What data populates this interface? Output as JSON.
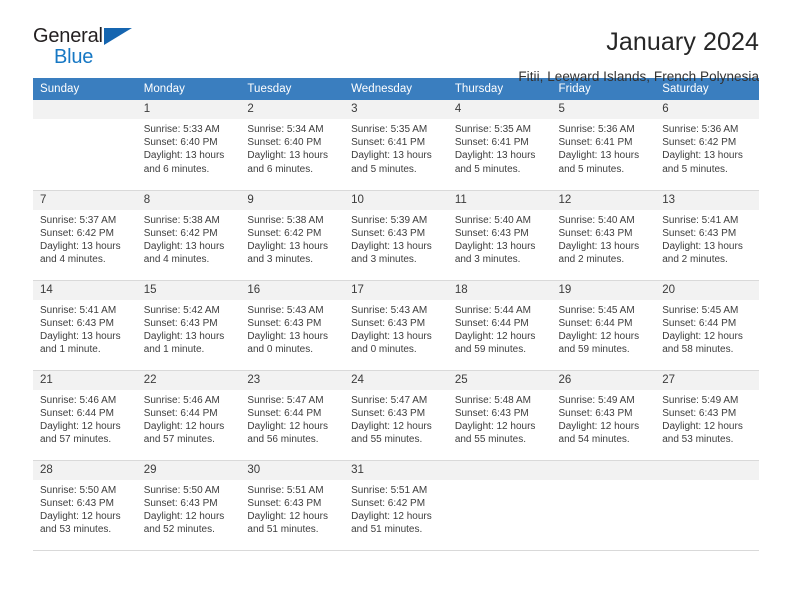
{
  "brand": {
    "name_top": "General",
    "name_bottom": "Blue",
    "triangle_color": "#1565b0",
    "blue_color": "#1778c4"
  },
  "header": {
    "title": "January 2024",
    "subtitle": "Fitii, Leeward Islands, French Polynesia",
    "accent_color": "#3a7ebf"
  },
  "calendar": {
    "weekday_headers": [
      "Sunday",
      "Monday",
      "Tuesday",
      "Wednesday",
      "Thursday",
      "Friday",
      "Saturday"
    ],
    "weeks": [
      [
        {
          "day": "",
          "sunrise": "",
          "sunset": "",
          "daylight_a": "",
          "daylight_b": ""
        },
        {
          "day": "1",
          "sunrise": "Sunrise: 5:33 AM",
          "sunset": "Sunset: 6:40 PM",
          "daylight_a": "Daylight: 13 hours",
          "daylight_b": "and 6 minutes."
        },
        {
          "day": "2",
          "sunrise": "Sunrise: 5:34 AM",
          "sunset": "Sunset: 6:40 PM",
          "daylight_a": "Daylight: 13 hours",
          "daylight_b": "and 6 minutes."
        },
        {
          "day": "3",
          "sunrise": "Sunrise: 5:35 AM",
          "sunset": "Sunset: 6:41 PM",
          "daylight_a": "Daylight: 13 hours",
          "daylight_b": "and 5 minutes."
        },
        {
          "day": "4",
          "sunrise": "Sunrise: 5:35 AM",
          "sunset": "Sunset: 6:41 PM",
          "daylight_a": "Daylight: 13 hours",
          "daylight_b": "and 5 minutes."
        },
        {
          "day": "5",
          "sunrise": "Sunrise: 5:36 AM",
          "sunset": "Sunset: 6:41 PM",
          "daylight_a": "Daylight: 13 hours",
          "daylight_b": "and 5 minutes."
        },
        {
          "day": "6",
          "sunrise": "Sunrise: 5:36 AM",
          "sunset": "Sunset: 6:42 PM",
          "daylight_a": "Daylight: 13 hours",
          "daylight_b": "and 5 minutes."
        }
      ],
      [
        {
          "day": "7",
          "sunrise": "Sunrise: 5:37 AM",
          "sunset": "Sunset: 6:42 PM",
          "daylight_a": "Daylight: 13 hours",
          "daylight_b": "and 4 minutes."
        },
        {
          "day": "8",
          "sunrise": "Sunrise: 5:38 AM",
          "sunset": "Sunset: 6:42 PM",
          "daylight_a": "Daylight: 13 hours",
          "daylight_b": "and 4 minutes."
        },
        {
          "day": "9",
          "sunrise": "Sunrise: 5:38 AM",
          "sunset": "Sunset: 6:42 PM",
          "daylight_a": "Daylight: 13 hours",
          "daylight_b": "and 3 minutes."
        },
        {
          "day": "10",
          "sunrise": "Sunrise: 5:39 AM",
          "sunset": "Sunset: 6:43 PM",
          "daylight_a": "Daylight: 13 hours",
          "daylight_b": "and 3 minutes."
        },
        {
          "day": "11",
          "sunrise": "Sunrise: 5:40 AM",
          "sunset": "Sunset: 6:43 PM",
          "daylight_a": "Daylight: 13 hours",
          "daylight_b": "and 3 minutes."
        },
        {
          "day": "12",
          "sunrise": "Sunrise: 5:40 AM",
          "sunset": "Sunset: 6:43 PM",
          "daylight_a": "Daylight: 13 hours",
          "daylight_b": "and 2 minutes."
        },
        {
          "day": "13",
          "sunrise": "Sunrise: 5:41 AM",
          "sunset": "Sunset: 6:43 PM",
          "daylight_a": "Daylight: 13 hours",
          "daylight_b": "and 2 minutes."
        }
      ],
      [
        {
          "day": "14",
          "sunrise": "Sunrise: 5:41 AM",
          "sunset": "Sunset: 6:43 PM",
          "daylight_a": "Daylight: 13 hours",
          "daylight_b": "and 1 minute."
        },
        {
          "day": "15",
          "sunrise": "Sunrise: 5:42 AM",
          "sunset": "Sunset: 6:43 PM",
          "daylight_a": "Daylight: 13 hours",
          "daylight_b": "and 1 minute."
        },
        {
          "day": "16",
          "sunrise": "Sunrise: 5:43 AM",
          "sunset": "Sunset: 6:43 PM",
          "daylight_a": "Daylight: 13 hours",
          "daylight_b": "and 0 minutes."
        },
        {
          "day": "17",
          "sunrise": "Sunrise: 5:43 AM",
          "sunset": "Sunset: 6:43 PM",
          "daylight_a": "Daylight: 13 hours",
          "daylight_b": "and 0 minutes."
        },
        {
          "day": "18",
          "sunrise": "Sunrise: 5:44 AM",
          "sunset": "Sunset: 6:44 PM",
          "daylight_a": "Daylight: 12 hours",
          "daylight_b": "and 59 minutes."
        },
        {
          "day": "19",
          "sunrise": "Sunrise: 5:45 AM",
          "sunset": "Sunset: 6:44 PM",
          "daylight_a": "Daylight: 12 hours",
          "daylight_b": "and 59 minutes."
        },
        {
          "day": "20",
          "sunrise": "Sunrise: 5:45 AM",
          "sunset": "Sunset: 6:44 PM",
          "daylight_a": "Daylight: 12 hours",
          "daylight_b": "and 58 minutes."
        }
      ],
      [
        {
          "day": "21",
          "sunrise": "Sunrise: 5:46 AM",
          "sunset": "Sunset: 6:44 PM",
          "daylight_a": "Daylight: 12 hours",
          "daylight_b": "and 57 minutes."
        },
        {
          "day": "22",
          "sunrise": "Sunrise: 5:46 AM",
          "sunset": "Sunset: 6:44 PM",
          "daylight_a": "Daylight: 12 hours",
          "daylight_b": "and 57 minutes."
        },
        {
          "day": "23",
          "sunrise": "Sunrise: 5:47 AM",
          "sunset": "Sunset: 6:44 PM",
          "daylight_a": "Daylight: 12 hours",
          "daylight_b": "and 56 minutes."
        },
        {
          "day": "24",
          "sunrise": "Sunrise: 5:47 AM",
          "sunset": "Sunset: 6:43 PM",
          "daylight_a": "Daylight: 12 hours",
          "daylight_b": "and 55 minutes."
        },
        {
          "day": "25",
          "sunrise": "Sunrise: 5:48 AM",
          "sunset": "Sunset: 6:43 PM",
          "daylight_a": "Daylight: 12 hours",
          "daylight_b": "and 55 minutes."
        },
        {
          "day": "26",
          "sunrise": "Sunrise: 5:49 AM",
          "sunset": "Sunset: 6:43 PM",
          "daylight_a": "Daylight: 12 hours",
          "daylight_b": "and 54 minutes."
        },
        {
          "day": "27",
          "sunrise": "Sunrise: 5:49 AM",
          "sunset": "Sunset: 6:43 PM",
          "daylight_a": "Daylight: 12 hours",
          "daylight_b": "and 53 minutes."
        }
      ],
      [
        {
          "day": "28",
          "sunrise": "Sunrise: 5:50 AM",
          "sunset": "Sunset: 6:43 PM",
          "daylight_a": "Daylight: 12 hours",
          "daylight_b": "and 53 minutes."
        },
        {
          "day": "29",
          "sunrise": "Sunrise: 5:50 AM",
          "sunset": "Sunset: 6:43 PM",
          "daylight_a": "Daylight: 12 hours",
          "daylight_b": "and 52 minutes."
        },
        {
          "day": "30",
          "sunrise": "Sunrise: 5:51 AM",
          "sunset": "Sunset: 6:43 PM",
          "daylight_a": "Daylight: 12 hours",
          "daylight_b": "and 51 minutes."
        },
        {
          "day": "31",
          "sunrise": "Sunrise: 5:51 AM",
          "sunset": "Sunset: 6:42 PM",
          "daylight_a": "Daylight: 12 hours",
          "daylight_b": "and 51 minutes."
        },
        {
          "day": "",
          "sunrise": "",
          "sunset": "",
          "daylight_a": "",
          "daylight_b": ""
        },
        {
          "day": "",
          "sunrise": "",
          "sunset": "",
          "daylight_a": "",
          "daylight_b": ""
        },
        {
          "day": "",
          "sunrise": "",
          "sunset": "",
          "daylight_a": "",
          "daylight_b": ""
        }
      ]
    ]
  }
}
